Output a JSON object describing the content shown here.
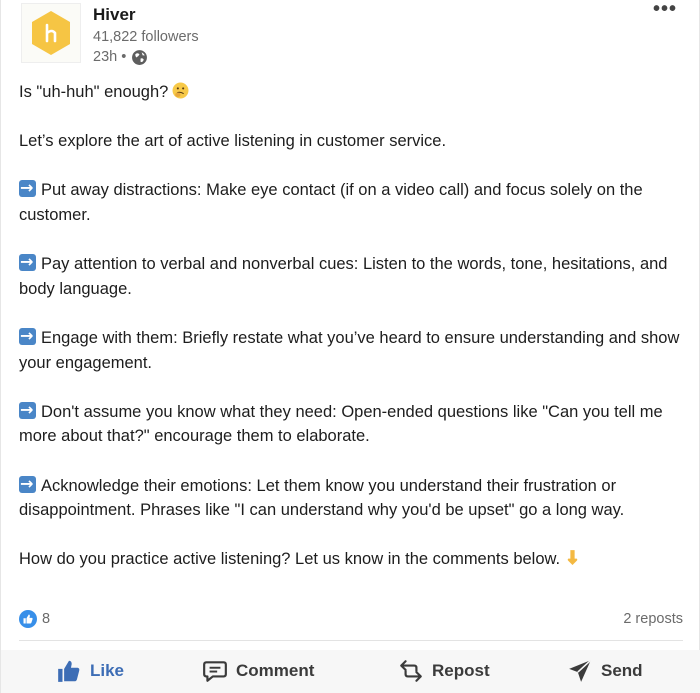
{
  "author": {
    "name": "Hiver",
    "followers": "41,822 followers",
    "time": "23h •",
    "logo_icon": "hiver-hexagon-logo",
    "brand_color": "#f6c544"
  },
  "post": {
    "lines": [
      {
        "text": "Is \"uh-huh\" enough?",
        "suffix_icon": "thinking-face-emoji"
      },
      {
        "text": "Let’s explore the art of active listening in customer service."
      },
      {
        "text": "Put away distractions: Make eye contact (if on a video call) and focus solely on the customer.",
        "prefix_icon": "right-arrow-emoji"
      },
      {
        "text": "Pay attention to verbal and nonverbal cues:  Listen to the words, tone, hesitations, and body language.",
        "prefix_icon": "right-arrow-emoji"
      },
      {
        "text": "Engage with them: Briefly restate what you’ve heard to ensure understanding and show your engagement.",
        "prefix_icon": "right-arrow-emoji"
      },
      {
        "text": "Don't assume you know what they need: Open-ended questions like \"Can you tell me more about that?\" encourage them to elaborate.",
        "prefix_icon": "right-arrow-emoji"
      },
      {
        "text": "Acknowledge their emotions: Let them know you understand their frustration or disappointment. Phrases like \"I can understand why you'd be upset\" go a long way.",
        "prefix_icon": "right-arrow-emoji"
      },
      {
        "text": "How do you practice active listening? Let us know in the comments below.",
        "suffix_icon": "pointing-down-emoji"
      }
    ]
  },
  "social": {
    "like_count": "8",
    "reposts": "2 reposts"
  },
  "actions": {
    "like": "Like",
    "comment": "Comment",
    "repost": "Repost",
    "send": "Send"
  }
}
